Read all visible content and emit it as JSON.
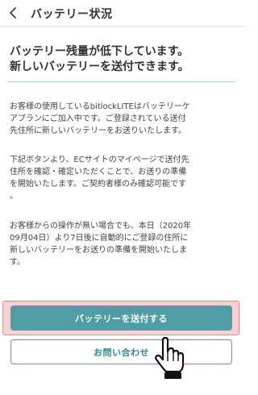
{
  "header": {
    "title": "バッテリー状況"
  },
  "headline": {
    "line1": "バッテリー残量が低下しています。",
    "line2": "新しいバッテリーを送付できます。"
  },
  "paragraphs": {
    "p1": [
      "お客様の使用しているbitlockLITEはバッテリーケ",
      "アプランにご加入中です。ご登録されている送付",
      "先住所に新しいバッテリーをお送りいたします。"
    ],
    "p2": [
      "下記ボタンより、ECサイトのマイページで送付先",
      "住所を確認・確定いただくことで、お送りの準備",
      "を開始いたします。ご契約者様のみ確認可能です",
      "。"
    ],
    "p3": [
      "お客様からの操作が無い場合でも、本日（2020年",
      "09月04日）より7日後に自動的にご登録の住所に",
      "新しいバッテリーをお送りの準備を開始いたしま",
      "す。"
    ]
  },
  "buttons": {
    "send": "バッテリーを送付する",
    "contact": "お問い合わせ"
  },
  "colors": {
    "accent": "#4f9ea5",
    "highlight": "#e8868b",
    "divider": "#9fd0d4"
  },
  "icons": {
    "back": "chevron-left-icon",
    "cursor": "hand-pointer-icon"
  }
}
